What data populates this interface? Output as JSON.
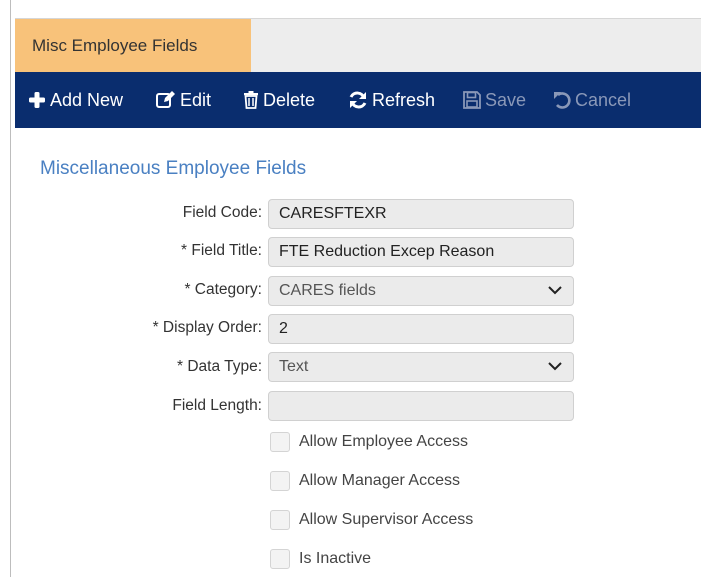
{
  "tab": {
    "label": "Misc Employee Fields"
  },
  "toolbar": {
    "add_new": "Add New",
    "edit": "Edit",
    "delete": "Delete",
    "refresh": "Refresh",
    "save": "Save",
    "cancel": "Cancel"
  },
  "form": {
    "title": "Miscellaneous Employee Fields",
    "field_code": {
      "label": "Field Code:",
      "value": "CARESFTEXR"
    },
    "field_title": {
      "label": "* Field Title:",
      "value": "FTE Reduction Excep Reason"
    },
    "category": {
      "label": "* Category:",
      "value": "CARES fields"
    },
    "display_order": {
      "label": "* Display Order:",
      "value": "2"
    },
    "data_type": {
      "label": "* Data Type:",
      "value": "Text"
    },
    "field_length": {
      "label": "Field Length:",
      "value": ""
    },
    "checkboxes": {
      "allow_employee": "Allow Employee Access",
      "allow_manager": "Allow Manager Access",
      "allow_supervisor": "Allow Supervisor Access",
      "is_inactive": "Is Inactive"
    }
  },
  "colors": {
    "toolbar_bg": "#0a2d6e",
    "active_tab_bg": "#f8c27a",
    "section_title": "#4a80c2",
    "disabled_button": "#8a98b8"
  }
}
